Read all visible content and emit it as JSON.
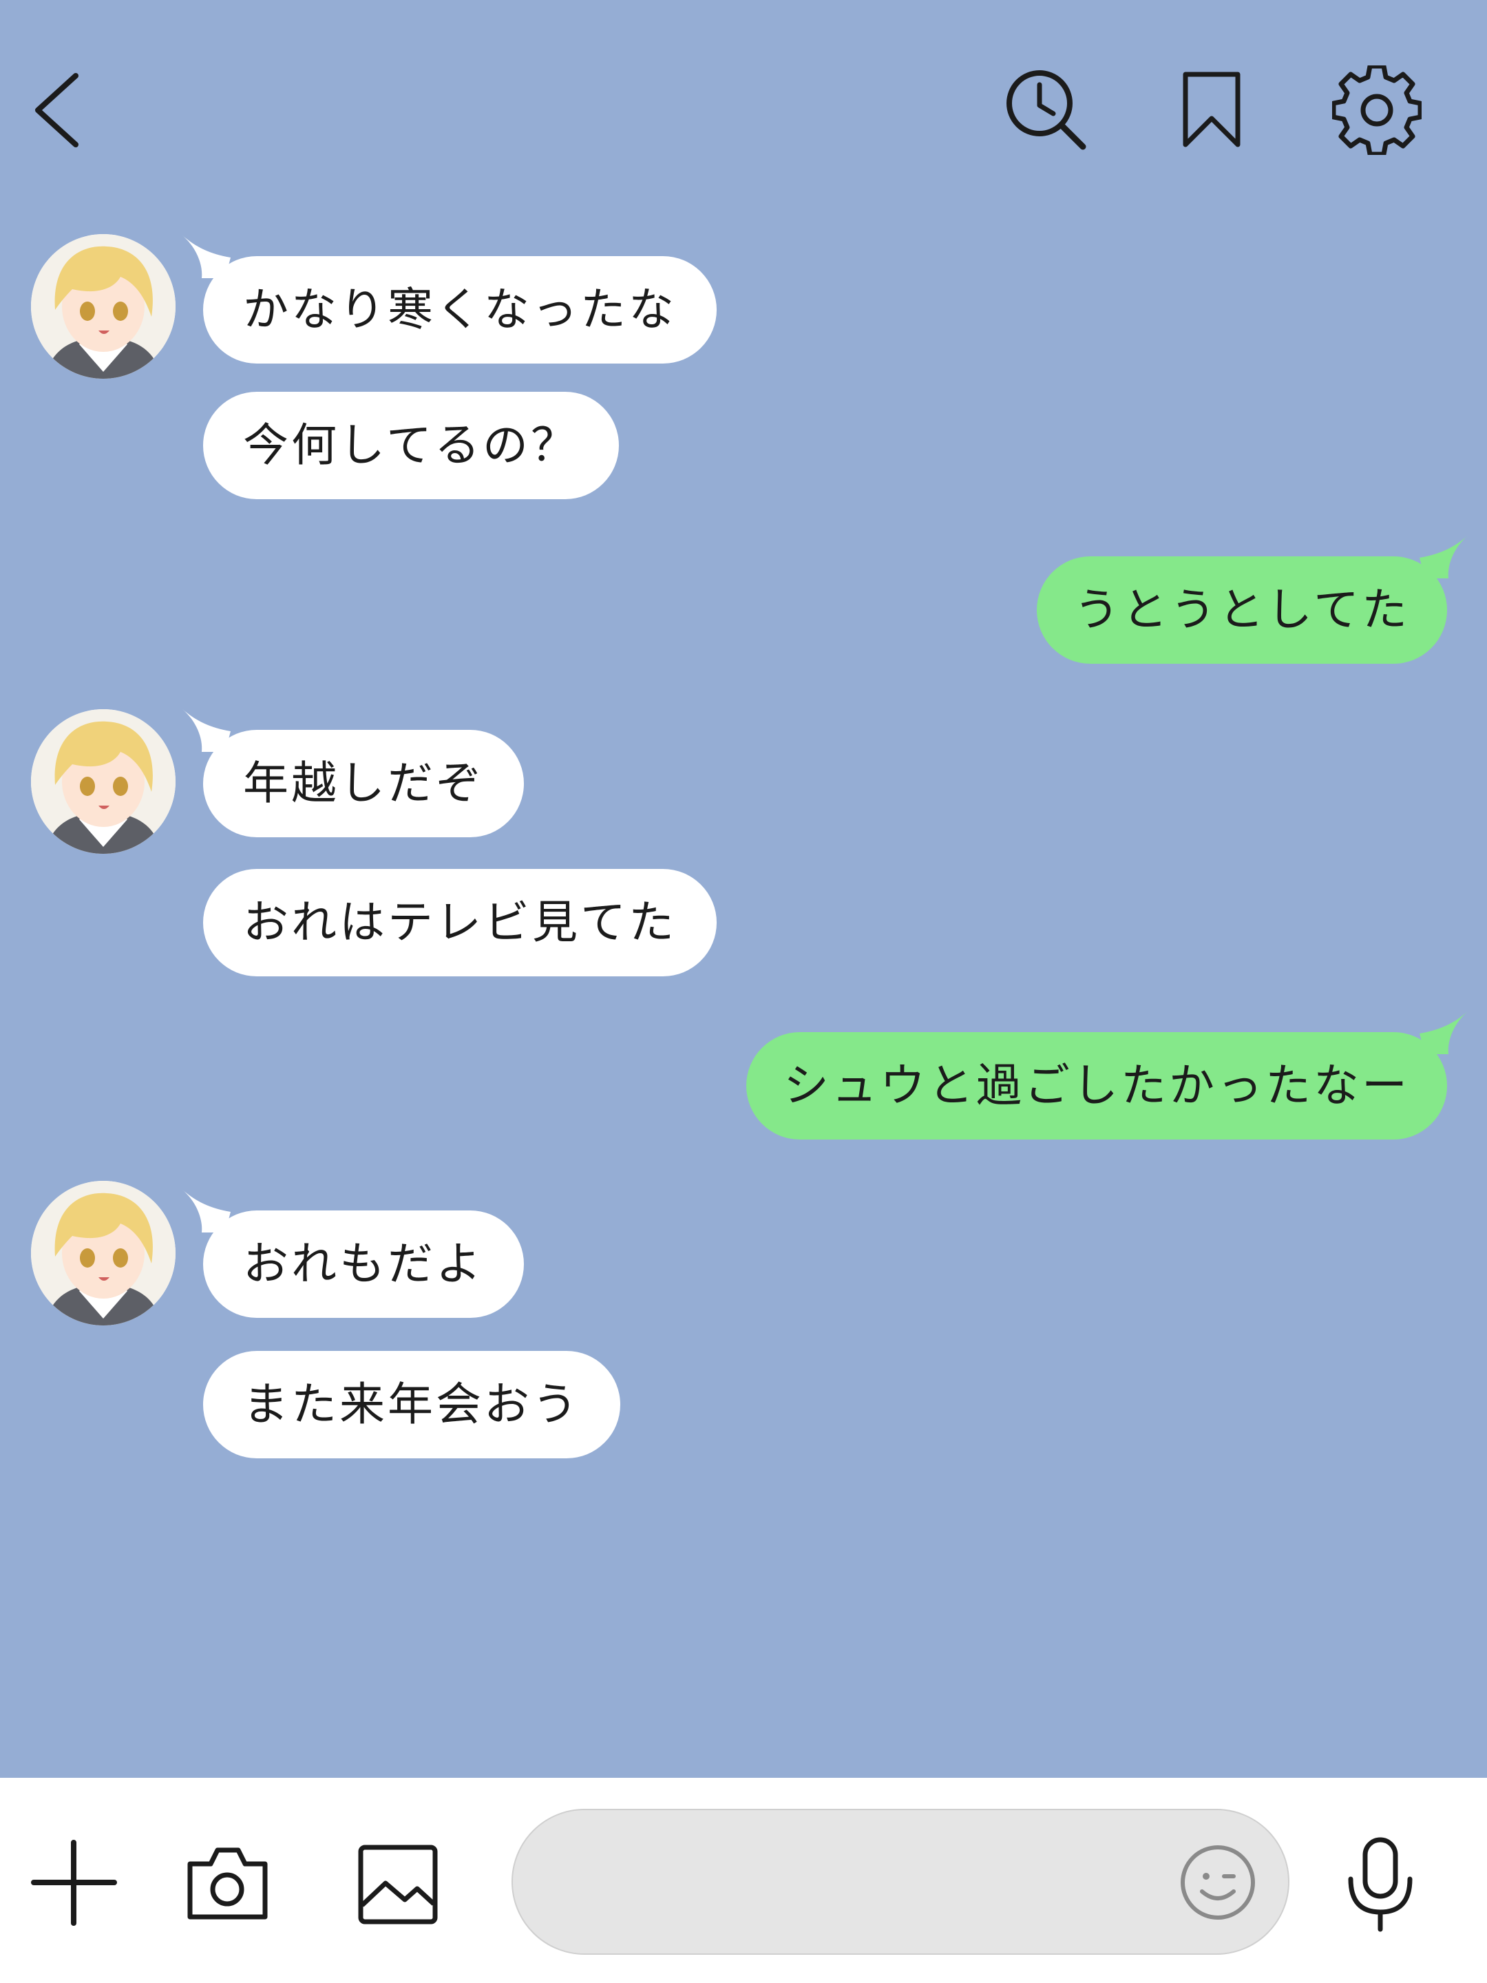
{
  "colors": {
    "background": "#95add4",
    "incoming_bubble": "#ffffff",
    "outgoing_bubble": "#85e88a",
    "icon_stroke": "#1b1b1b"
  },
  "header": {
    "icons": [
      "chevron-left-icon",
      "history-search-icon",
      "bookmark-icon",
      "gear-icon"
    ]
  },
  "messages": [
    {
      "sender": "friend",
      "text": "かなり寒くなったな"
    },
    {
      "sender": "friend",
      "text": "今何してるの？"
    },
    {
      "sender": "me",
      "text": "うとうとしてた"
    },
    {
      "sender": "friend",
      "text": "年越しだぞ"
    },
    {
      "sender": "friend",
      "text": "おれはテレビ見てた"
    },
    {
      "sender": "me",
      "text": "シュウと過ごしたかったなー"
    },
    {
      "sender": "friend",
      "text": "おれもだよ"
    },
    {
      "sender": "friend",
      "text": "また来年会おう"
    }
  ],
  "input": {
    "value": "",
    "placeholder": "",
    "icons": [
      "plus-icon",
      "camera-icon",
      "image-icon",
      "emoji-icon",
      "microphone-icon"
    ]
  }
}
